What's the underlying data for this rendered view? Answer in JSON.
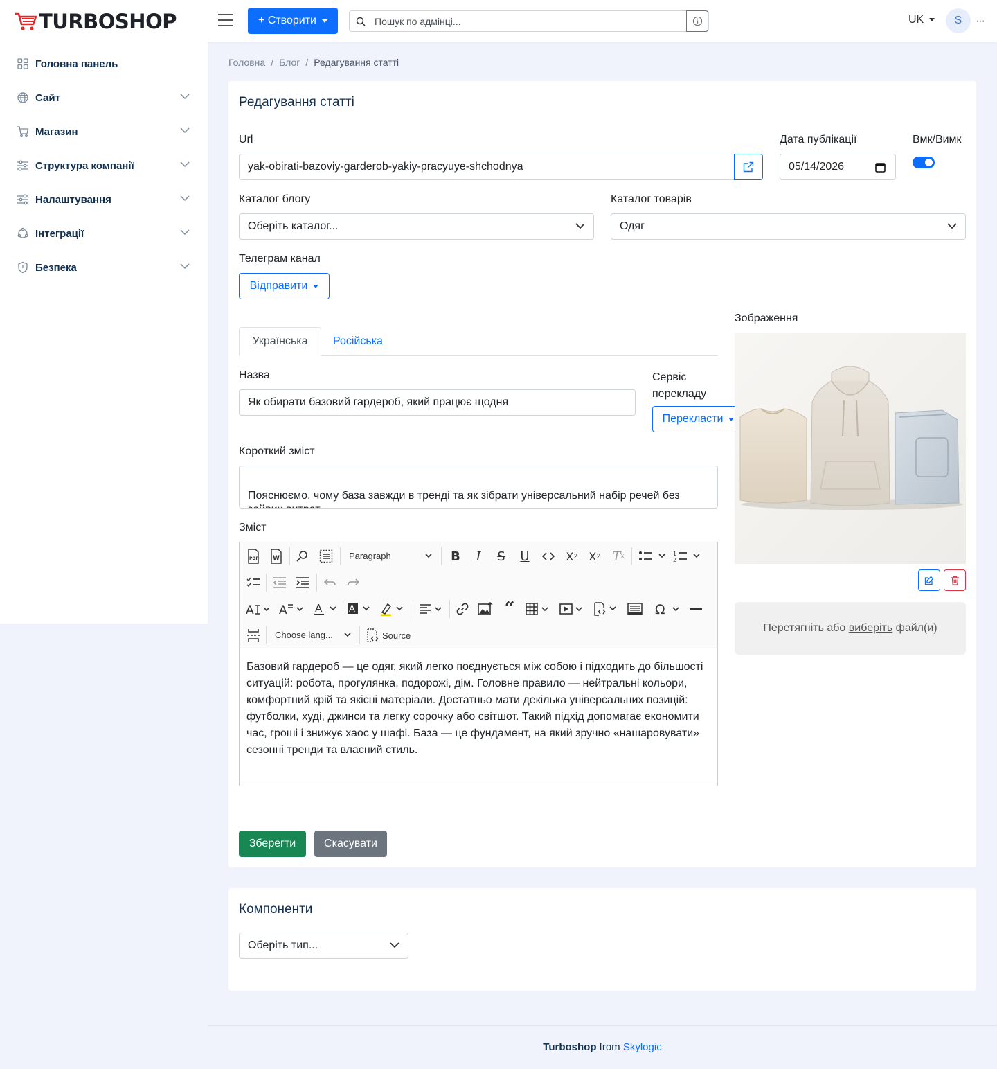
{
  "header": {
    "logo_text": "TURBOSHOP",
    "create_label": "+ Створити",
    "search_placeholder": "Пошук по адмінці...",
    "lang": "UK",
    "avatar_initial": "S",
    "more": "···"
  },
  "sidebar": {
    "items": [
      {
        "label": "Головна панель",
        "icon": "dashboard-icon"
      },
      {
        "label": "Сайт",
        "icon": "globe-icon"
      },
      {
        "label": "Магазин",
        "icon": "cart-icon"
      },
      {
        "label": "Структура компанії",
        "icon": "sliders-icon"
      },
      {
        "label": "Налаштування",
        "icon": "settings-sliders-icon"
      },
      {
        "label": "Інтеграції",
        "icon": "integration-icon"
      },
      {
        "label": "Безпека",
        "icon": "shield-icon"
      }
    ]
  },
  "breadcrumb": {
    "home": "Головна",
    "blog": "Блог",
    "current": "Редагування статті",
    "separator": "/"
  },
  "form": {
    "title": "Редагування статті",
    "url_label": "Url",
    "url_value": "yak-obirati-bazoviy-garderob-yakiy-pracyuye-shchodnya",
    "date_label": "Дата публікації",
    "date_value": "05/14/2026",
    "toggle_label": "Вмк/Вимк",
    "toggle_on": true,
    "blog_catalog_label": "Каталог блогу",
    "blog_catalog_value": "Оберіть каталог...",
    "product_catalog_label": "Каталог товарів",
    "product_catalog_value": "Одяг",
    "telegram_label": "Телеграм канал",
    "send_label": "Відправити",
    "tabs": [
      "Українська",
      "Російська"
    ],
    "name_label": "Назва",
    "name_value": "Як обирати базовий гардероб, який працює щодня",
    "translate_service_label": "Сервіс перекладу",
    "translate_label": "Перекласти",
    "summary_label": "Короткий зміст",
    "summary_value": "Пояснюємо, чому база завжди в тренді та як зібрати універсальний набір речей без зайвих витрат.",
    "content_label": "Зміст",
    "content_value": "Базовий гардероб — це одяг, який легко поєднується між собою і підходить до більшості ситуацій: робота, прогулянка, подорожі, дім. Головне правило — нейтральні кольори, комфортний крій та якісні матеріали. Достатньо мати декілька універсальних позицій: футболки, худі, джинси та легку сорочку або світшот. Такий підхід допомагає економити час, гроші і знижує хаос у шафі. База — це фундамент, на який зручно «нашаровувати» сезонні тренди та власний стиль.",
    "image_label": "Зображення",
    "dropzone_text_before": "Перетягніть або",
    "dropzone_link": "виберіть",
    "dropzone_text_after": "файл(и)",
    "save_label": "Зберегти",
    "cancel_label": "Скасувати"
  },
  "editor_toolbar": {
    "paragraph": "Paragraph",
    "language": "Choose lang...",
    "source": "Source"
  },
  "components": {
    "title": "Компоненти",
    "type_placeholder": "Оберіть тип..."
  },
  "footer": {
    "brand": "Turboshop",
    "from": "from",
    "company": "Skylogic"
  },
  "colors": {
    "primary": "#0d6efd",
    "success": "#198754",
    "secondary": "#6c757d",
    "danger": "#dc3545",
    "logo_red": "#e02a2a",
    "nav_text": "#12304f"
  }
}
